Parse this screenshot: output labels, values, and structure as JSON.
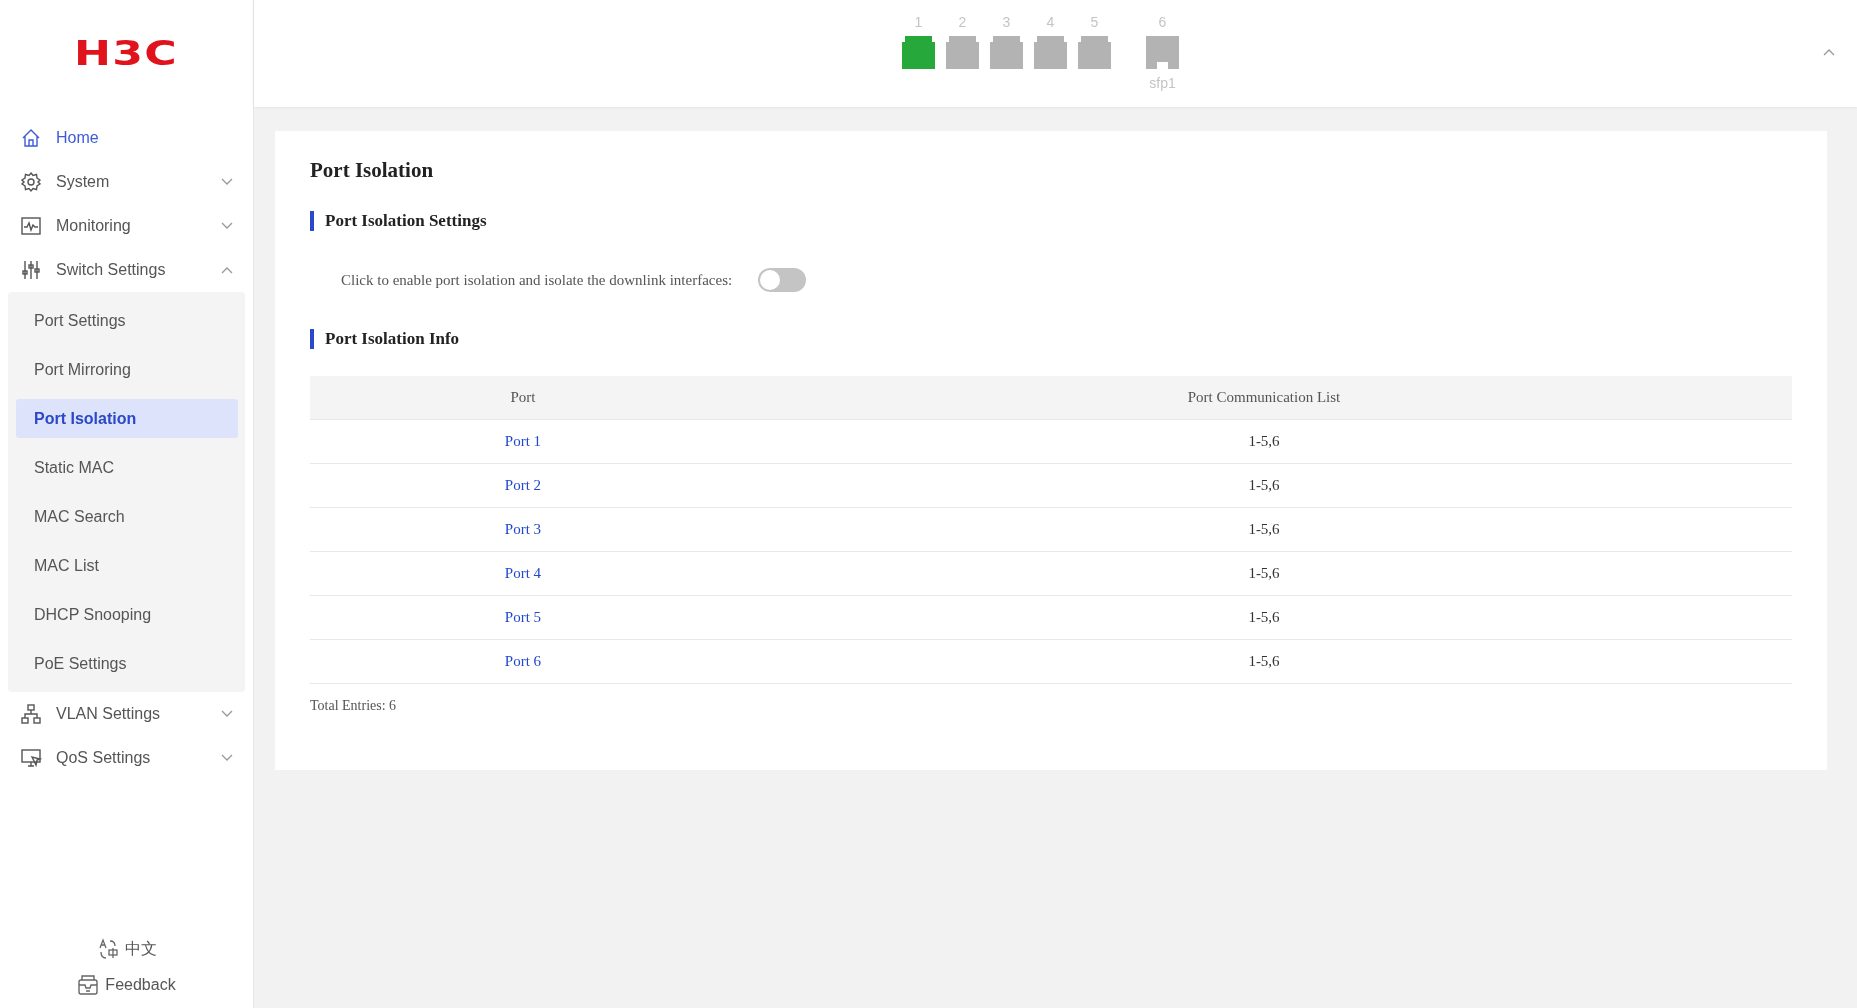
{
  "logo": "H3C",
  "nav": [
    {
      "label": "Home",
      "kind": "link",
      "selected": true
    },
    {
      "label": "System",
      "kind": "group",
      "selected": false,
      "expanded": false
    },
    {
      "label": "Monitoring",
      "kind": "group",
      "selected": false,
      "expanded": false
    },
    {
      "label": "Switch Settings",
      "kind": "group",
      "selected": false,
      "expanded": true,
      "children": [
        {
          "label": "Port Settings",
          "selected": false
        },
        {
          "label": "Port Mirroring",
          "selected": false
        },
        {
          "label": "Port Isolation",
          "selected": true
        },
        {
          "label": "Static MAC",
          "selected": false
        },
        {
          "label": "MAC Search",
          "selected": false
        },
        {
          "label": "MAC List",
          "selected": false
        },
        {
          "label": "DHCP Snooping",
          "selected": false
        },
        {
          "label": "PoE Settings",
          "selected": false
        }
      ]
    },
    {
      "label": "VLAN Settings",
      "kind": "group",
      "selected": false,
      "expanded": false
    },
    {
      "label": "QoS Settings",
      "kind": "group",
      "selected": false,
      "expanded": false
    }
  ],
  "footer": {
    "language": "中文",
    "feedback": "Feedback"
  },
  "ports": [
    {
      "number": "1",
      "kind": "rj45",
      "up": true
    },
    {
      "number": "2",
      "kind": "rj45",
      "up": false
    },
    {
      "number": "3",
      "kind": "rj45",
      "up": false
    },
    {
      "number": "4",
      "kind": "rj45",
      "up": false
    },
    {
      "number": "5",
      "kind": "rj45",
      "up": false
    },
    {
      "number": "6",
      "kind": "sfp",
      "up": false,
      "label": "sfp1"
    }
  ],
  "page": {
    "title": "Port Isolation",
    "settings": {
      "heading": "Port Isolation Settings",
      "toggle_label": "Click to enable port isolation and isolate the downlink interfaces:",
      "on": false
    },
    "info": {
      "heading": "Port Isolation Info",
      "columns": [
        "Port",
        "Port Communication List"
      ],
      "rows": [
        [
          "Port 1",
          "1-5,6"
        ],
        [
          "Port 2",
          "1-5,6"
        ],
        [
          "Port 3",
          "1-5,6"
        ],
        [
          "Port 4",
          "1-5,6"
        ],
        [
          "Port 5",
          "1-5,6"
        ],
        [
          "Port 6",
          "1-5,6"
        ]
      ],
      "total": "Total Entries: 6"
    }
  }
}
